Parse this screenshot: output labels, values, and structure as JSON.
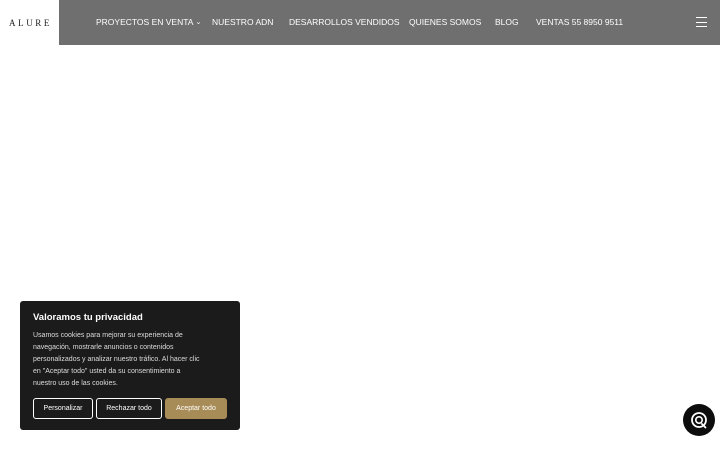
{
  "brand": {
    "logo_text": "ALURE"
  },
  "nav": {
    "items": [
      {
        "label": "PROYECTOS EN VENTA",
        "has_dropdown": true
      },
      {
        "label": "NUESTRO ADN"
      },
      {
        "label": "DESARROLLOS VENDIDOS"
      },
      {
        "label": "QUIENES SOMOS"
      },
      {
        "label": "BLOG"
      },
      {
        "label": "VENTAS 55 8950 9511"
      }
    ],
    "dropdown_icon": "chevron-down-icon",
    "menu_icon": "hamburger-menu-icon"
  },
  "cookie_banner": {
    "title": "Valoramos tu privacidad",
    "body_lines": [
      "Usamos cookies para mejorar su experiencia de",
      "navegación, mostrarle anuncios o contenidos",
      "personalizados y analizar nuestro tráfico. Al hacer clic",
      "en \"Aceptar todo\" usted da su consentimiento a",
      "nuestro uso de las cookies."
    ],
    "buttons": {
      "customize": "Personalizar",
      "reject": "Rechazar todo",
      "accept": "Aceptar todo"
    }
  },
  "chat": {
    "icon": "chat-support-icon"
  },
  "colors": {
    "header_bg": "#6f6f6f",
    "banner_bg": "#1b1b1b",
    "accent": "#a88c57"
  }
}
